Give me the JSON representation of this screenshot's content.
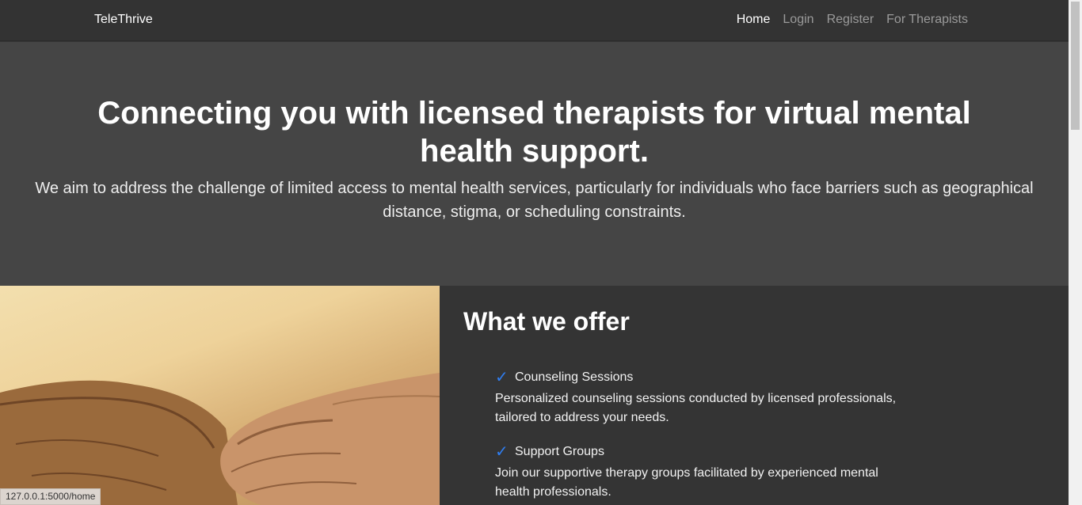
{
  "navbar": {
    "brand": "TeleThrive",
    "links": [
      {
        "label": "Home",
        "active": true
      },
      {
        "label": "Login"
      },
      {
        "label": "Register"
      },
      {
        "label": "For Therapists"
      }
    ]
  },
  "hero": {
    "title": "Connecting you with licensed therapists for virtual mental health support.",
    "text": "We aim to address the challenge of limited access to mental health services, particularly for individuals who face barriers such as geographical distance, stigma, or scheduling constraints."
  },
  "image": {
    "icon": "fist-bump-photo"
  },
  "offer": {
    "title": "What we offer",
    "items": [
      {
        "icon": "check-icon",
        "check": "✓",
        "title": "Counseling Sessions",
        "description": "Personalized counseling sessions conducted by licensed professionals, tailored to address your needs."
      },
      {
        "icon": "check-icon",
        "check": "✓",
        "title": "Support Groups",
        "description": "Join our supportive therapy groups facilitated by experienced mental health professionals."
      }
    ]
  },
  "status": {
    "url": "127.0.0.1:5000/home"
  },
  "colors": {
    "accent": "#2f7df0",
    "hero_bg": "#454545",
    "page_bg": "#343434"
  }
}
